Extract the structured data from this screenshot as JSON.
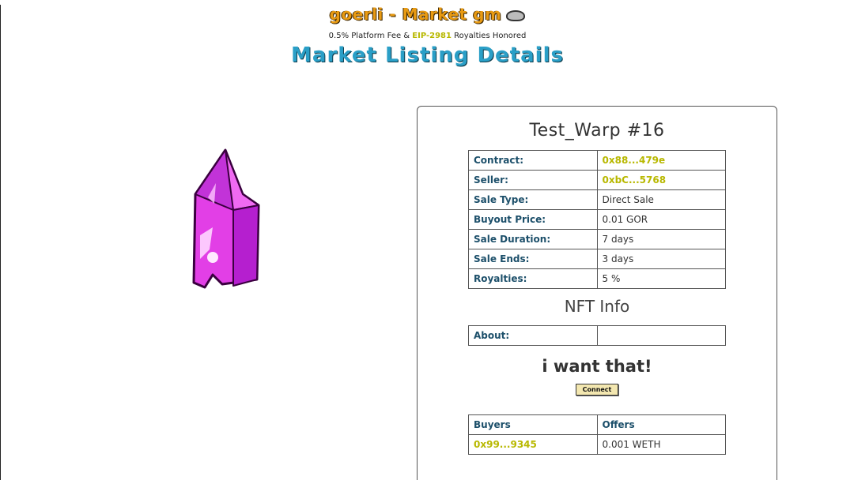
{
  "header": {
    "site_title": "goerli - Market gm",
    "fee_prefix": "0.5% Platform Fee & ",
    "fee_eip": "EIP-2981",
    "fee_suffix": " Royalties Honored",
    "page_title": "Market Listing Details"
  },
  "listing": {
    "name": "Test_Warp #16",
    "rows": [
      {
        "key": "Contract:",
        "value": "0x88...479e"
      },
      {
        "key": "Seller:",
        "value": "0xbC...5768"
      },
      {
        "key": "Sale Type:",
        "value": "Direct Sale"
      },
      {
        "key": "Buyout Price:",
        "value": "0.01 GOR"
      },
      {
        "key": "Sale Duration:",
        "value": "7 days"
      },
      {
        "key": "Sale Ends:",
        "value": "3 days"
      },
      {
        "key": "Royalties:",
        "value": "5 %"
      }
    ]
  },
  "nft_info": {
    "title": "NFT Info",
    "about_label": "About:",
    "about_value": ""
  },
  "purchase": {
    "title": "i want that!",
    "connect_label": "Connect"
  },
  "offers": {
    "header_buyers": "Buyers",
    "header_offers": "Offers",
    "rows": [
      {
        "buyer": "0x99...9345",
        "offer": "0.001 WETH"
      }
    ]
  },
  "colors": {
    "title_orange": "#e89a12",
    "page_title_blue": "#2a9fc7",
    "address_yellow": "#b8b800",
    "key_blue": "#1c4f6a",
    "crystal_magenta": "#e23fe6"
  }
}
